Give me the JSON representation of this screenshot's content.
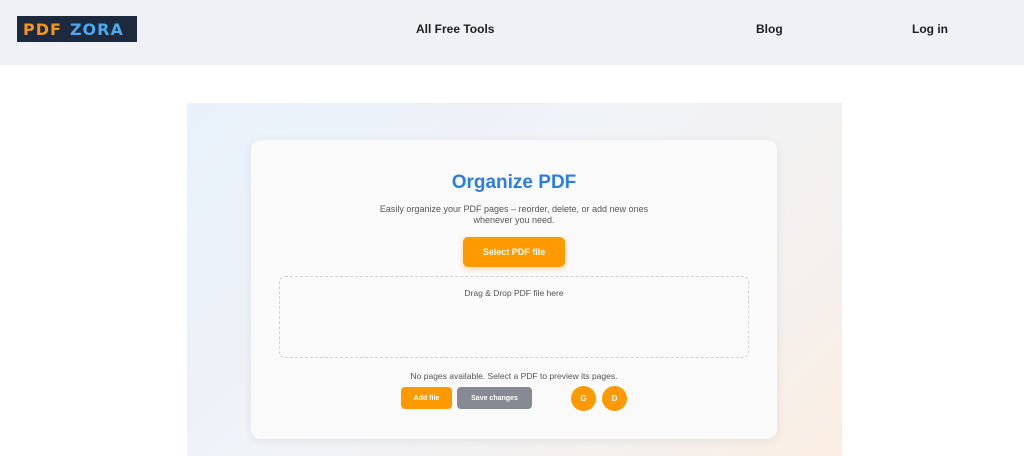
{
  "navbar": {
    "logo": {
      "part1": "PDF",
      "part2": "ZORA"
    },
    "links": {
      "tools": "All Free Tools",
      "blog": "Blog",
      "login": "Log in"
    }
  },
  "card": {
    "title": "Organize PDF",
    "subtitle": "Easily organize your PDF pages – reorder, delete, or add new ones whenever you need.",
    "select_button": "Select PDF file",
    "dropzone_text": "Drag & Drop PDF file here",
    "empty_message": "No pages available. Select a PDF to preview its pages.",
    "add_button": "Add file",
    "save_button": "Save changes",
    "g_button": "G",
    "d_button": "D"
  },
  "colors": {
    "accent": "#ff9900",
    "title": "#2b7de0",
    "navbar_bg": "#eff1f5",
    "logo_bg": "#1d2a3d",
    "secondary_button": "#868a92"
  }
}
